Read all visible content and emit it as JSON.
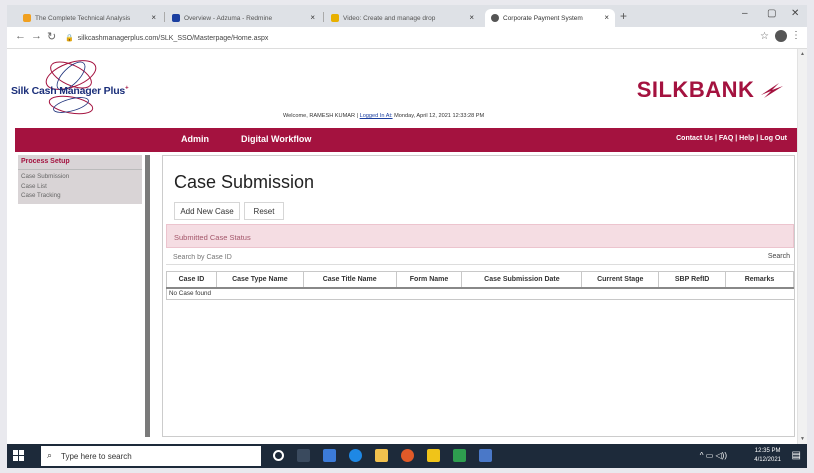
{
  "browser": {
    "tabs": [
      {
        "label": "The Complete Technical Analysis",
        "color": "#f0a020"
      },
      {
        "label": "Overview - Adzuma - Redmine",
        "color": "#1b3fa0"
      },
      {
        "label": "Video: Create and manage drop",
        "color": "#e8b000"
      },
      {
        "label": "Corporate Payment System",
        "color": "#555555"
      }
    ],
    "tab_close": "×",
    "new_tab": "+",
    "url": "silkcashmanagerplus.com/SLK_SSO/Masterpage/Home.aspx",
    "window_minimize": "–",
    "window_restore": "▢",
    "window_close": "✕"
  },
  "header": {
    "logo_text": "Silk Cash Manager Plus",
    "logo_mark": "+",
    "brand": "SILKBANK",
    "welcome_prefix": "Welcome, RAMESH KUMAR | ",
    "logged_in_label": "Logged In At:",
    "login_time": " Monday, April 12, 2021 12:33:28 PM"
  },
  "nav": {
    "items": [
      "Admin",
      "Digital Workflow"
    ],
    "right_links": "Contact Us | FAQ | Help | Log Out"
  },
  "sidebar": {
    "heading": "Process Setup",
    "items": [
      "Case Submission",
      "Case List",
      "Case Tracking"
    ]
  },
  "main": {
    "title": "Case Submission",
    "add_button": "Add New Case",
    "reset_button": "Reset",
    "status_heading": "Submitted Case Status",
    "search_placeholder": "Search by Case ID",
    "search_button": "Search",
    "columns": [
      "Case ID",
      "Case Type Name",
      "Case Title Name",
      "Form Name",
      "Case Submission Date",
      "Current Stage",
      "SBP RefID",
      "Remarks"
    ],
    "empty_text": "No Case found"
  },
  "taskbar": {
    "search_placeholder": "Type here to search",
    "time": "12:35 PM",
    "date": "4/12/2021"
  },
  "colors": {
    "brand": "#a4123f",
    "taskbar": "#1d2a3a"
  }
}
